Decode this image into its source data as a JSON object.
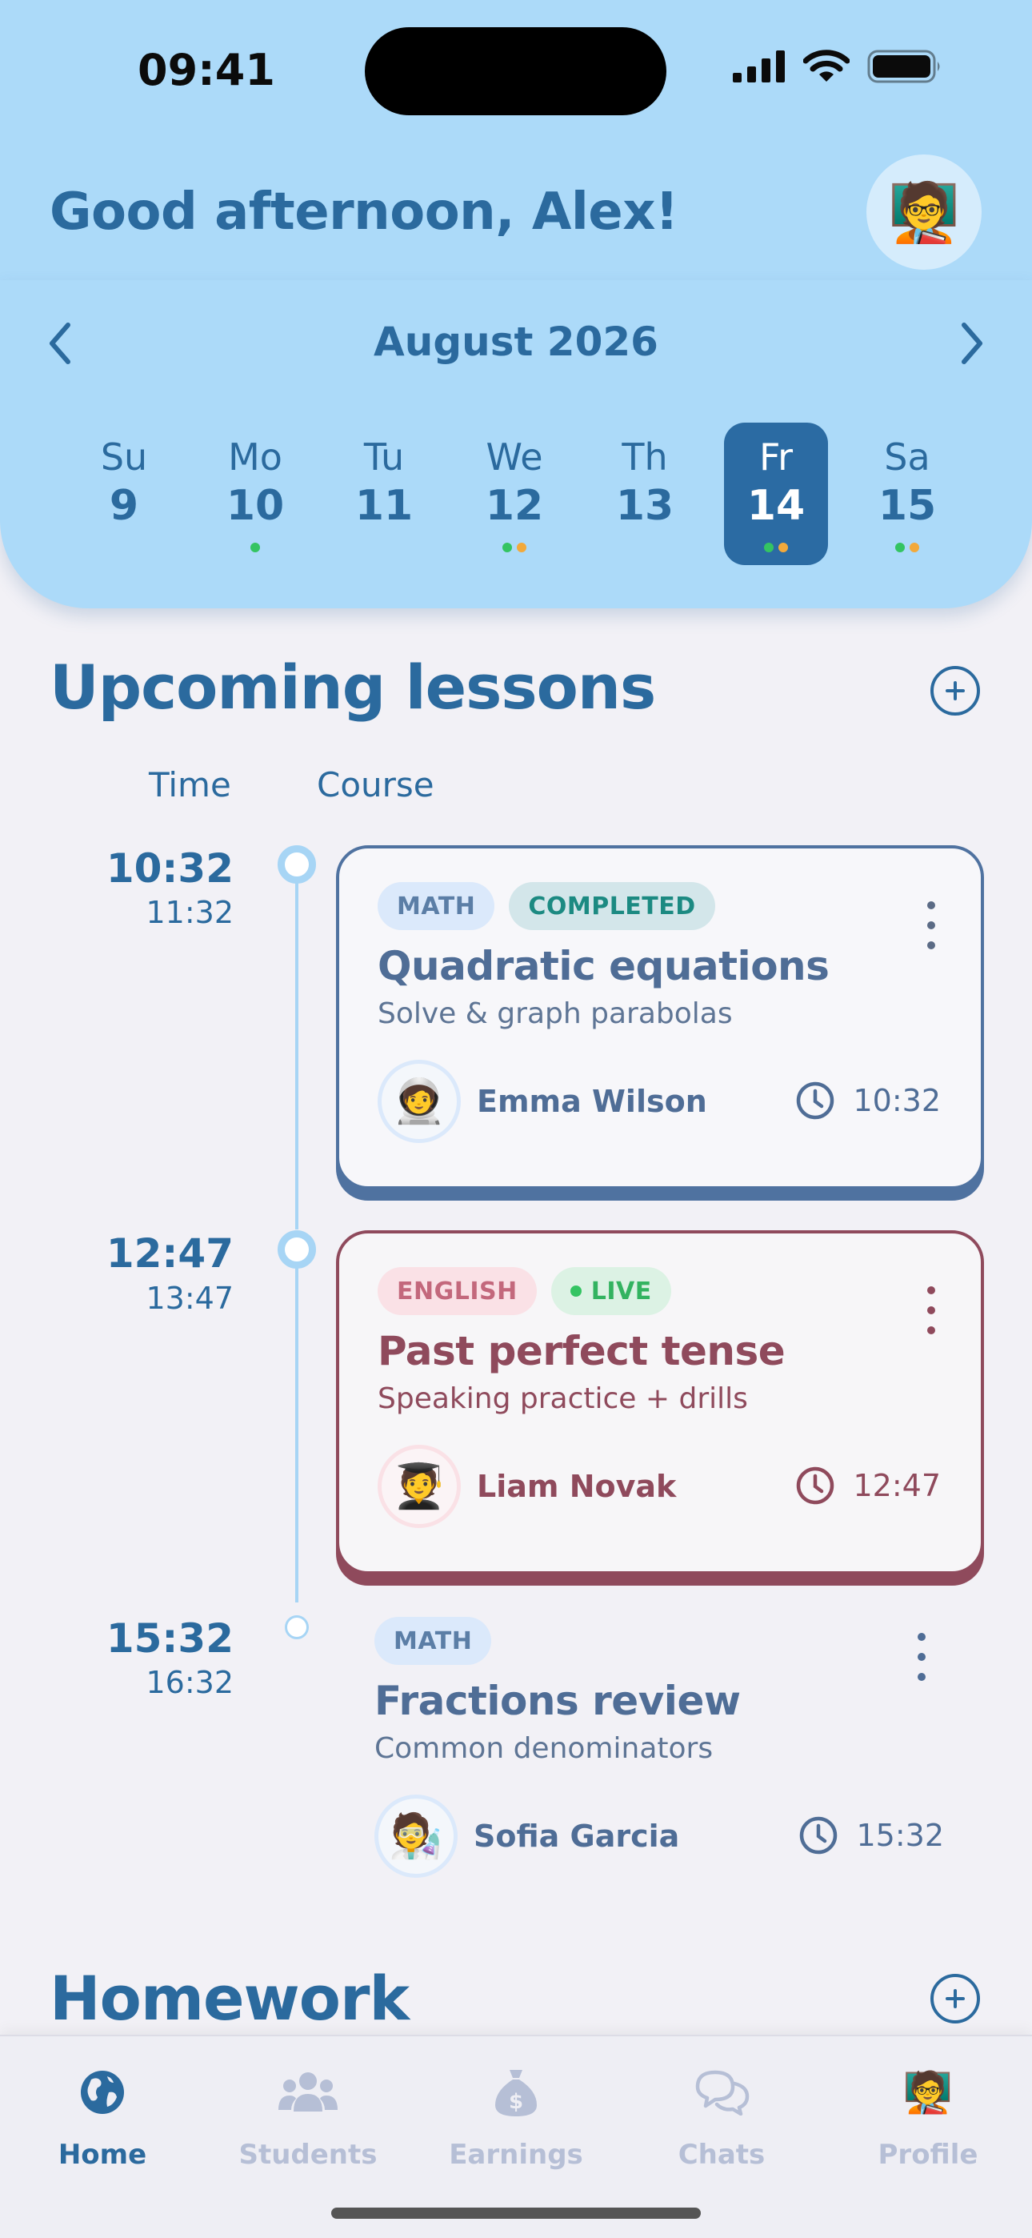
{
  "status_bar": {
    "time": "09:41"
  },
  "header": {
    "greeting": "Good afternoon, Alex!",
    "avatar_emoji": "🧑‍🏫"
  },
  "calendar": {
    "month_label": "August 2026",
    "days": [
      {
        "name": "Su",
        "date": "9",
        "selected": false,
        "dots": []
      },
      {
        "name": "Mo",
        "date": "10",
        "selected": false,
        "dots": [
          "#34c462"
        ]
      },
      {
        "name": "Tu",
        "date": "11",
        "selected": false,
        "dots": []
      },
      {
        "name": "We",
        "date": "12",
        "selected": false,
        "dots": [
          "#34c462",
          "#f2a93b"
        ]
      },
      {
        "name": "Th",
        "date": "13",
        "selected": false,
        "dots": []
      },
      {
        "name": "Fr",
        "date": "14",
        "selected": true,
        "dots": [
          "#34c462",
          "#f2a93b"
        ]
      },
      {
        "name": "Sa",
        "date": "15",
        "selected": false,
        "dots": [
          "#34c462",
          "#f2a93b"
        ]
      }
    ]
  },
  "upcoming": {
    "title": "Upcoming lessons",
    "col_time": "Time",
    "col_course": "Course",
    "lessons": [
      {
        "start": "10:32",
        "end": "11:32",
        "subject": "MATH",
        "status": "COMPLETED",
        "title": "Quadratic equations",
        "subtitle": "Solve & graph parabolas",
        "teacher": "Emma Wilson",
        "teacher_emoji": "🧑‍🚀",
        "time": "10:32"
      },
      {
        "start": "12:47",
        "end": "13:47",
        "subject": "ENGLISH",
        "status": "LIVE",
        "title": "Past perfect tense",
        "subtitle": "Speaking practice + drills",
        "teacher": "Liam Novak",
        "teacher_emoji": "🧑‍🎓",
        "time": "12:47"
      },
      {
        "start": "15:32",
        "end": "16:32",
        "subject": "MATH",
        "title": "Fractions review",
        "subtitle": "Common denominators",
        "teacher": "Sofia Garcia",
        "teacher_emoji": "🧑‍🔬",
        "time": "15:32"
      }
    ]
  },
  "homework": {
    "title": "Homework"
  },
  "tabs": [
    {
      "label": "Home",
      "icon": "globe-icon",
      "active": true
    },
    {
      "label": "Students",
      "icon": "people-icon",
      "active": false
    },
    {
      "label": "Earnings",
      "icon": "money-bag-icon",
      "active": false
    },
    {
      "label": "Chats",
      "icon": "chat-bubbles-icon",
      "active": false
    },
    {
      "label": "Profile",
      "icon": "profile-avatar-icon",
      "active": false
    }
  ],
  "colors": {
    "header_bg": "#acdaf9",
    "accent": "#2b6a9e",
    "math_card": "#4f72a0",
    "english_card": "#8f4a5c",
    "live_green": "#34c462",
    "event_orange": "#f2a93b"
  }
}
